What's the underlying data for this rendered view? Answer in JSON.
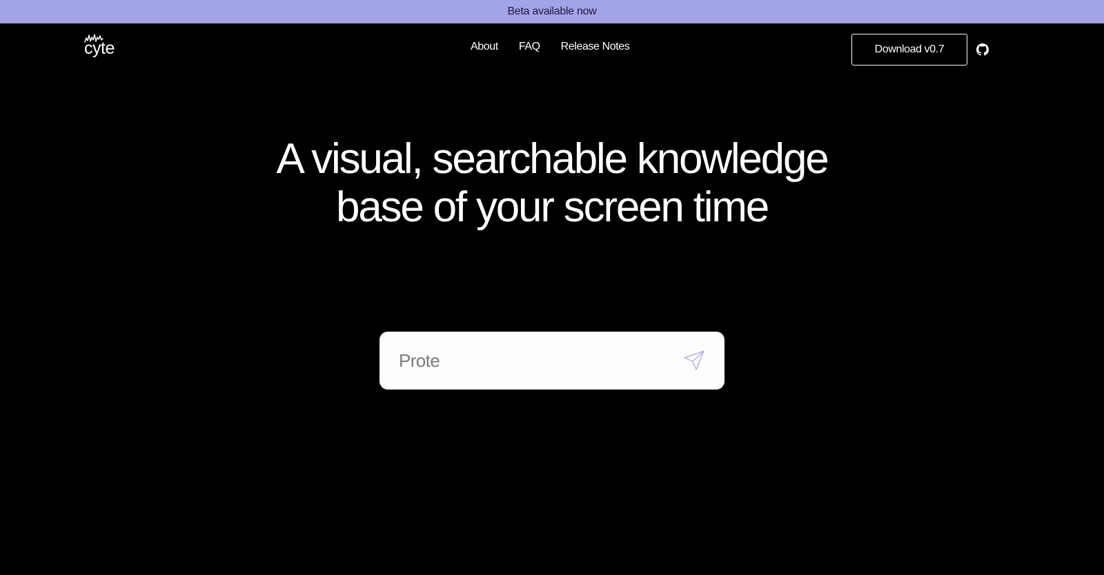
{
  "banner": {
    "text": "Beta available now"
  },
  "logo": {
    "text": "cyte"
  },
  "nav": {
    "links": [
      {
        "label": "About"
      },
      {
        "label": "FAQ"
      },
      {
        "label": "Release Notes"
      }
    ],
    "download_label": "Download v0.7",
    "github_icon": "github-icon"
  },
  "hero": {
    "title_line1": "A visual, searchable knowledge",
    "title_line2": "base of your screen time"
  },
  "search": {
    "value": "Prote",
    "send_icon": "send-icon"
  },
  "colors": {
    "banner_bg": "#a3a3e8",
    "page_bg": "#000000",
    "accent_icon": "#b4b0e8"
  }
}
